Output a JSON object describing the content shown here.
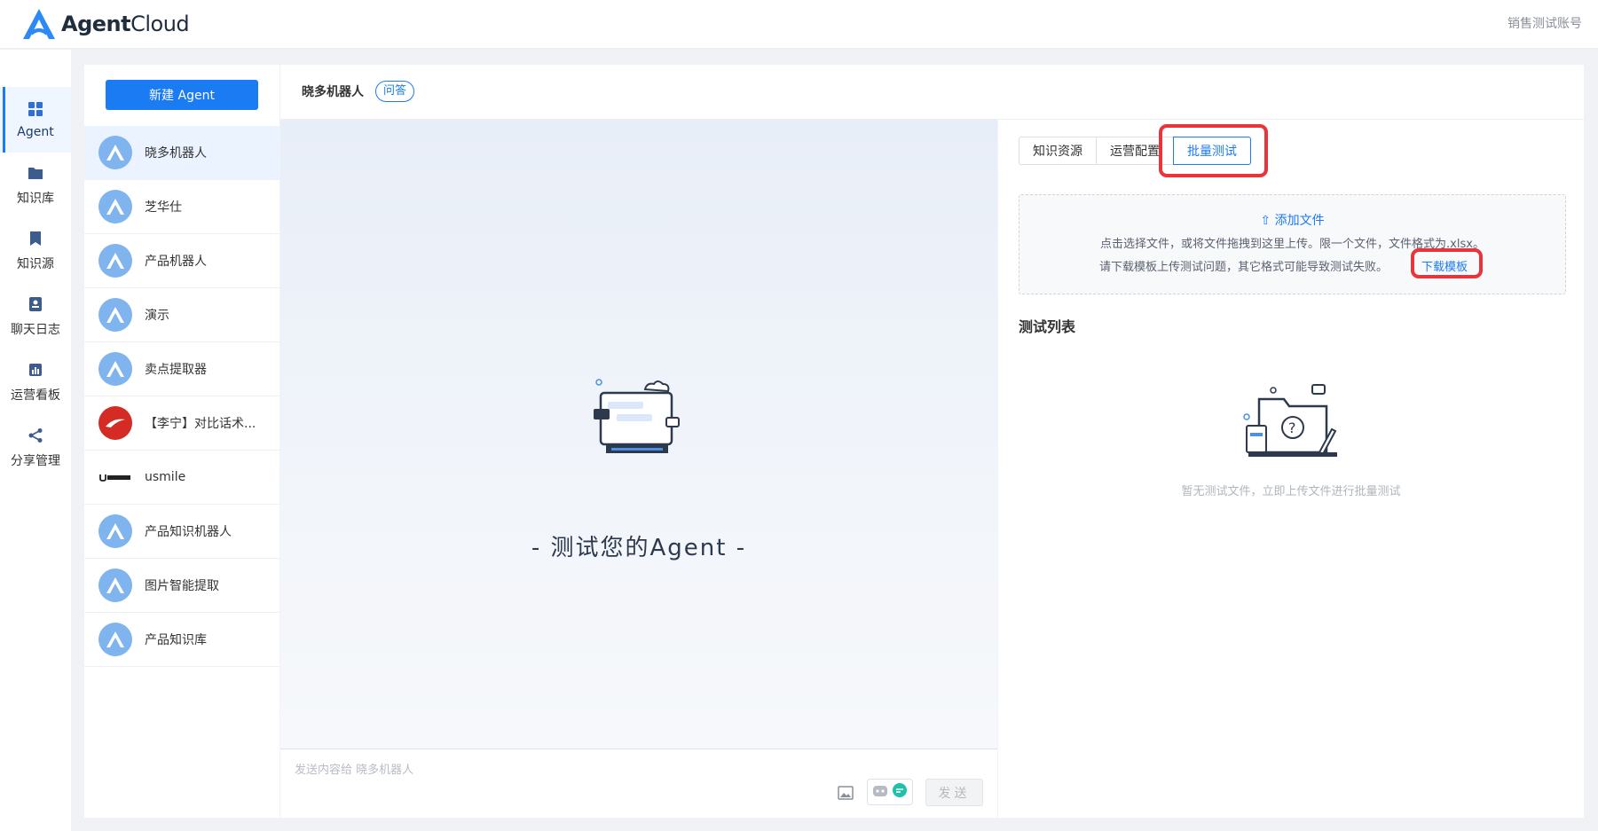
{
  "app": {
    "logo_bold": "Agent",
    "logo_light": "Cloud",
    "account": "销售测试账号"
  },
  "sidebar": {
    "items": [
      {
        "label": "Agent",
        "icon": "grid-icon",
        "active": true
      },
      {
        "label": "知识库",
        "icon": "folder-icon"
      },
      {
        "label": "知识源",
        "icon": "bookmark-icon"
      },
      {
        "label": "聊天日志",
        "icon": "log-icon"
      },
      {
        "label": "运营看板",
        "icon": "chart-icon"
      },
      {
        "label": "分享管理",
        "icon": "share-icon"
      }
    ]
  },
  "agents": {
    "new_button": "新建 Agent",
    "items": [
      {
        "name": "晓多机器人",
        "avatar": "agent-logo",
        "active": true
      },
      {
        "name": "芝华仕",
        "avatar": "agent-logo"
      },
      {
        "name": "产品机器人",
        "avatar": "agent-logo"
      },
      {
        "name": "演示",
        "avatar": "agent-logo"
      },
      {
        "name": "卖点提取器",
        "avatar": "agent-logo"
      },
      {
        "name": "【李宁】对比话术...",
        "avatar": "lining-logo"
      },
      {
        "name": "usmile",
        "avatar": "usmile-logo"
      },
      {
        "name": "产品知识机器人",
        "avatar": "agent-logo"
      },
      {
        "name": "图片智能提取",
        "avatar": "agent-logo"
      },
      {
        "name": "产品知识库",
        "avatar": "agent-logo"
      }
    ]
  },
  "chat": {
    "title": "晓多机器人",
    "tag": "问答",
    "slogan": "- 测试您的Agent -",
    "input_placeholder": "发送内容给 晓多机器人",
    "send_label": "发送"
  },
  "config": {
    "tabs": [
      {
        "label": "知识资源"
      },
      {
        "label": "运营配置"
      },
      {
        "label": "批量测试",
        "active": true
      }
    ],
    "upload": {
      "link": "添加文件",
      "line1": "点击选择文件，或将文件拖拽到这里上传。限一个文件，文件格式为.xlsx。",
      "line2": "请下载模板上传测试问题，其它格式可能导致测试失败。",
      "download": "下载模板"
    },
    "list_title": "测试列表",
    "empty_text": "暂无测试文件，立即上传文件进行批量测试"
  },
  "colors": {
    "primary": "#1a7bf2",
    "highlight": "#e8343a",
    "avatar": "#7fb4ef"
  }
}
